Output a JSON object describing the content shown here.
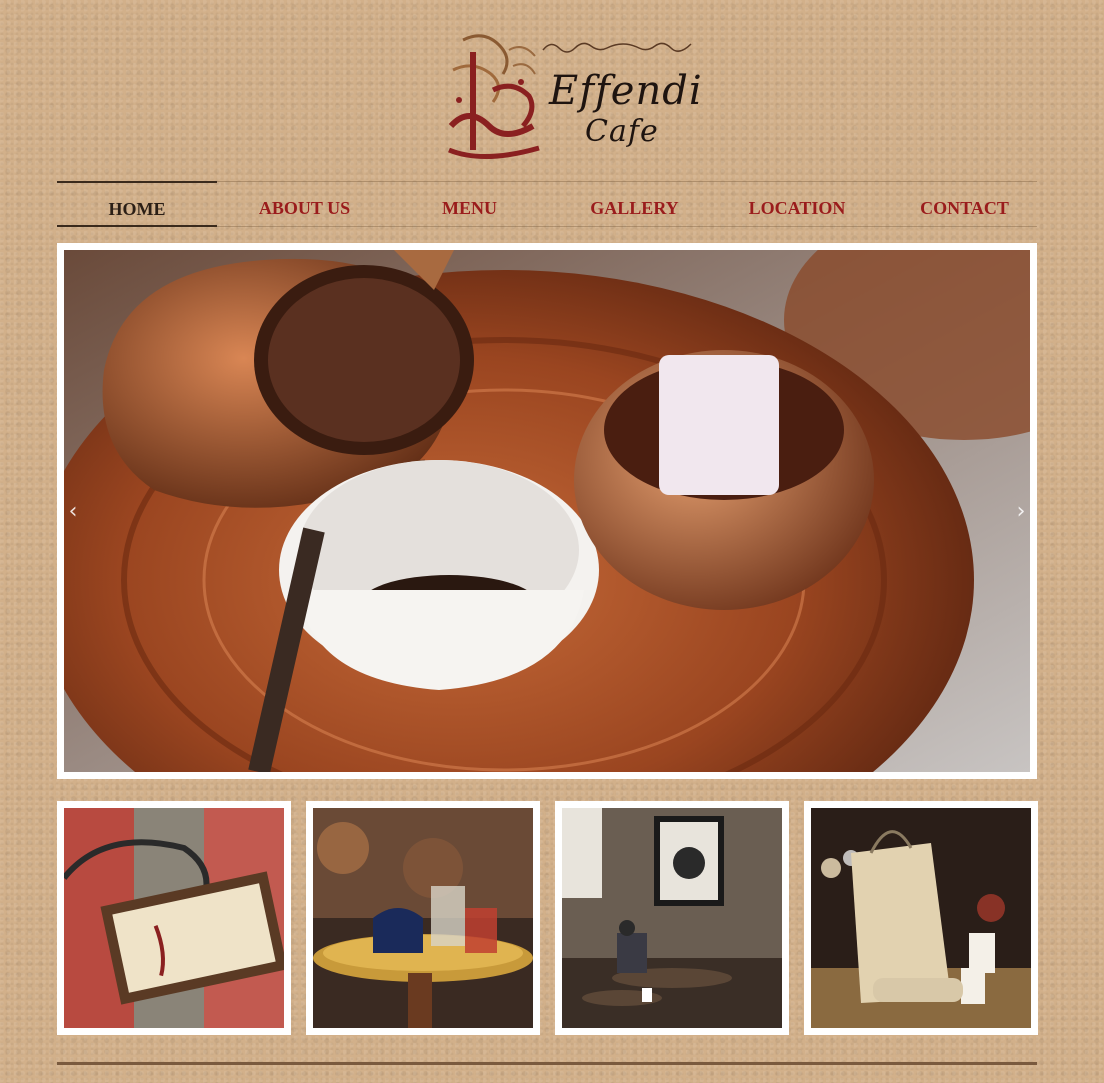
{
  "brand": {
    "logo_name": "Effendi",
    "logo_sub": "Cafe",
    "colors": {
      "primary": "#9a1c1c",
      "active": "#2b1f16",
      "background": "#d2b08a"
    }
  },
  "nav": {
    "items": [
      {
        "label": "HOME",
        "active": true
      },
      {
        "label": "ABOUT US",
        "active": false
      },
      {
        "label": "MENU",
        "active": false
      },
      {
        "label": "GALLERY",
        "active": false
      },
      {
        "label": "LOCATION",
        "active": false
      },
      {
        "label": "CONTACT",
        "active": false
      }
    ]
  },
  "hero": {
    "image": "turkish-coffee-copper-tray",
    "prev_icon": "chevron-left-icon",
    "next_icon": "chevron-right-icon"
  },
  "gallery": {
    "thumbnails": [
      {
        "image": "cafe-hanging-sign"
      },
      {
        "image": "tea-glasses-brass-tray"
      },
      {
        "image": "cafe-interior-seating"
      },
      {
        "image": "branded-bag-and-cups"
      }
    ]
  }
}
